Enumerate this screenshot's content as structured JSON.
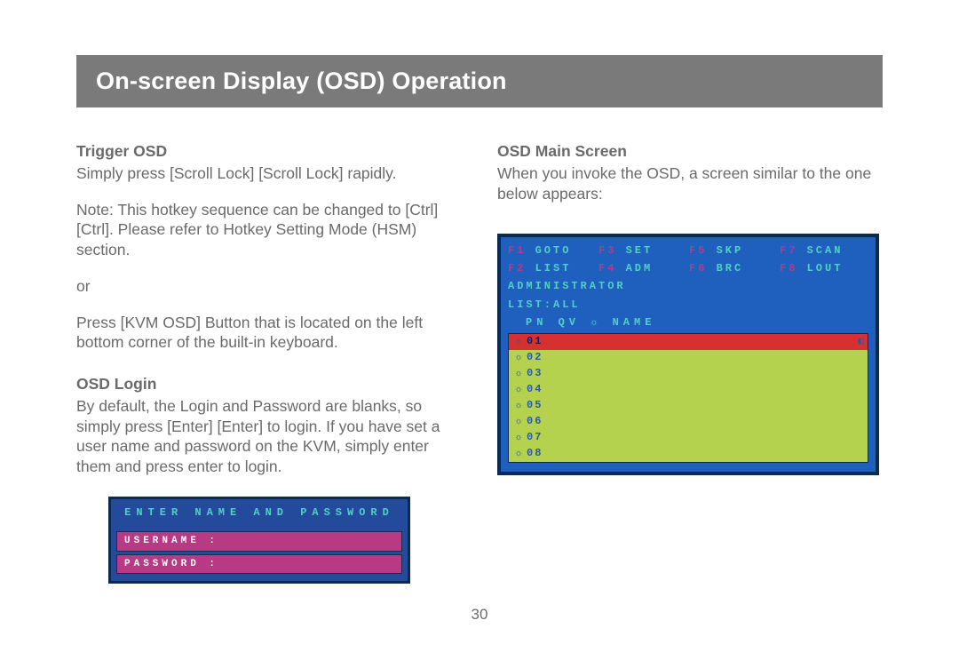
{
  "header": {
    "title": "On-screen Display (OSD) Operation"
  },
  "left": {
    "trigger": {
      "heading": "Trigger OSD",
      "p1": "Simply press [Scroll Lock] [Scroll Lock] rapidly.",
      "p2": "Note: This hotkey sequence can be changed to [Ctrl] [Ctrl]. Please refer to Hotkey Setting Mode (HSM) section.",
      "p3": "or",
      "p4": "Press [KVM OSD] Button that is located on the left bottom corner of the built-in keyboard."
    },
    "login": {
      "heading": "OSD Login",
      "p1": "By default, the Login and Password are blanks, so simply press [Enter] [Enter] to login. If you have set a user name and password on the KVM, simply enter them and press enter to login."
    },
    "login_screenshot": {
      "title": "ENTER NAME AND PASSWORD",
      "user_label": "USERNAME :",
      "pass_label": "PASSWORD :"
    }
  },
  "right": {
    "main": {
      "heading": "OSD Main Screen",
      "p1": "When you invoke the OSD, a screen similar to the one below appears:"
    },
    "osd": {
      "menu": [
        {
          "key": "F1",
          "label": "GOTO"
        },
        {
          "key": "F3",
          "label": "SET"
        },
        {
          "key": "F5",
          "label": "SKP"
        },
        {
          "key": "F7",
          "label": "SCAN"
        },
        {
          "key": "F2",
          "label": "LIST"
        },
        {
          "key": "F4",
          "label": "ADM"
        },
        {
          "key": "F6",
          "label": "BRC"
        },
        {
          "key": "F8",
          "label": "LOUT"
        }
      ],
      "admin_line": "ADMINISTRATOR",
      "list_line": " LIST:ALL",
      "col_header": "PN   QV ☼  NAME",
      "ports": [
        "01",
        "02",
        "03",
        "04",
        "05",
        "06",
        "07",
        "08"
      ]
    }
  },
  "page_number": "30"
}
